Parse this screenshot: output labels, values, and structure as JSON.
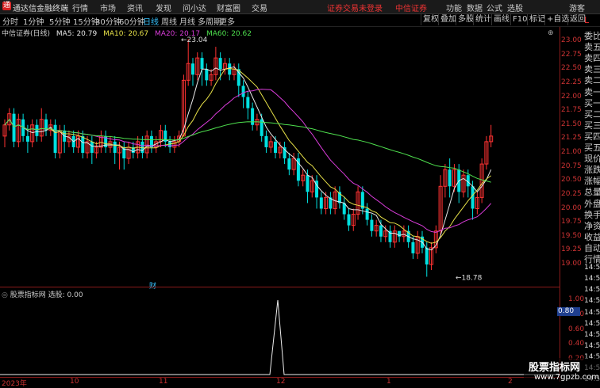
{
  "app": {
    "name": "通达信金融终端",
    "logo_text": "通"
  },
  "menu": [
    "行情",
    "市场",
    "资讯",
    "发现",
    "问小达",
    "财富圈",
    "交易"
  ],
  "status_red": [
    "证券交易未登录",
    "中信证券"
  ],
  "top_right": [
    "功能",
    "数据",
    "公式",
    "选股",
    "游客"
  ],
  "periods": [
    "分时",
    "1分钟",
    "5分钟",
    "15分钟",
    "30分钟",
    "60分钟",
    "日线",
    "周线",
    "月线",
    "多周期",
    "更多"
  ],
  "active_period": "日线",
  "toolbar_buttons": [
    "复权",
    "叠加",
    "多股",
    "统计",
    "画线",
    "F10",
    "标记",
    "+自选",
    "返回"
  ],
  "stock": {
    "title": "中信证券(日线)"
  },
  "ma": [
    {
      "label": "MA5: 20.79",
      "color": "#e8e8e8"
    },
    {
      "label": "MA10: 20.67",
      "color": "#e6e048"
    },
    {
      "label": "MA20: 20.17",
      "color": "#d93cd9"
    },
    {
      "label": "MA60: 20.62",
      "color": "#4ee04e"
    }
  ],
  "y_labels": [
    "23.00",
    "22.75",
    "22.50",
    "22.25",
    "22.00",
    "21.75",
    "21.50",
    "21.25",
    "21.00",
    "20.75",
    "20.50",
    "20.25",
    "20.00",
    "19.75",
    "19.50",
    "19.25",
    "19.00"
  ],
  "high_label": "23.04",
  "low_label": "18.78",
  "finance_mark": "财",
  "side_panel": [
    "委比",
    "卖五",
    "卖四",
    "卖三",
    "卖二",
    "卖一",
    "买一",
    "买二",
    "买三",
    "买四",
    "买五",
    "现价",
    "涨跌",
    "涨幅",
    "总量",
    "外盘",
    "换手",
    "净资",
    "收益",
    "自动",
    "行情",
    "14:50",
    "14:50",
    "14:50",
    "14:50",
    "14:50",
    "14:50",
    "14:50",
    "14:50",
    "14:50",
    "14:50",
    "14:50"
  ],
  "side_header": "L",
  "indicator": {
    "name": "股票指标网",
    "value_label": "选股: 0.00",
    "current": "0.80"
  },
  "sub_y_labels": [
    "1.00",
    "0.80",
    "0.60",
    "0.40",
    "0.20"
  ],
  "x_labels": [
    "2023年",
    "10",
    "11",
    "12",
    "1",
    "2"
  ],
  "watermark": {
    "line1": "股票指标网",
    "line2": "www.7gpzb.com"
  },
  "candles": [
    [
      21.3,
      21.5,
      21.1,
      21.6
    ],
    [
      21.5,
      21.7,
      21.4,
      21.8
    ],
    [
      21.7,
      21.2,
      21.1,
      21.8
    ],
    [
      21.2,
      21.6,
      21.1,
      21.7
    ],
    [
      21.6,
      21.3,
      21.2,
      21.7
    ],
    [
      21.3,
      21.2,
      21.0,
      21.5
    ],
    [
      21.2,
      21.5,
      21.1,
      21.6
    ],
    [
      21.5,
      21.3,
      21.2,
      21.6
    ],
    [
      21.3,
      21.6,
      21.2,
      21.8
    ],
    [
      21.6,
      21.4,
      21.3,
      21.7
    ],
    [
      21.4,
      21.5,
      21.3,
      21.6
    ],
    [
      21.5,
      21.0,
      20.9,
      21.6
    ],
    [
      21.0,
      21.4,
      20.9,
      21.5
    ],
    [
      21.4,
      21.2,
      21.0,
      21.5
    ],
    [
      21.2,
      21.3,
      21.1,
      21.4
    ],
    [
      21.3,
      21.1,
      21.0,
      21.4
    ],
    [
      21.1,
      21.3,
      21.0,
      21.4
    ],
    [
      21.3,
      21.0,
      20.9,
      21.4
    ],
    [
      21.0,
      21.2,
      20.9,
      21.3
    ],
    [
      21.2,
      21.0,
      20.8,
      21.3
    ],
    [
      21.0,
      21.1,
      20.9,
      21.2
    ],
    [
      21.1,
      21.3,
      21.0,
      21.4
    ],
    [
      21.3,
      21.1,
      21.0,
      21.4
    ],
    [
      21.1,
      21.2,
      21.0,
      21.3
    ],
    [
      21.2,
      21.0,
      20.8,
      21.3
    ],
    [
      21.0,
      21.1,
      20.7,
      21.2
    ],
    [
      21.1,
      20.9,
      20.7,
      21.2
    ],
    [
      20.9,
      21.1,
      20.8,
      21.2
    ],
    [
      21.1,
      21.0,
      20.9,
      21.2
    ],
    [
      21.0,
      21.2,
      20.9,
      21.3
    ],
    [
      21.2,
      21.0,
      20.9,
      21.3
    ],
    [
      21.0,
      21.3,
      20.9,
      21.4
    ],
    [
      21.3,
      21.1,
      21.0,
      21.4
    ],
    [
      21.1,
      21.2,
      21.0,
      21.3
    ],
    [
      21.2,
      21.4,
      21.1,
      21.5
    ],
    [
      21.4,
      21.2,
      21.1,
      21.5
    ],
    [
      21.2,
      21.1,
      21.0,
      21.3
    ],
    [
      21.1,
      21.2,
      21.0,
      21.3
    ],
    [
      21.2,
      21.3,
      21.1,
      21.4
    ],
    [
      21.3,
      22.3,
      21.3,
      22.4
    ],
    [
      22.3,
      22.6,
      22.2,
      23.04
    ],
    [
      22.6,
      22.4,
      22.2,
      22.7
    ],
    [
      22.4,
      22.7,
      22.3,
      22.8
    ],
    [
      22.7,
      22.5,
      22.2,
      22.8
    ],
    [
      22.5,
      22.3,
      22.2,
      22.6
    ],
    [
      22.3,
      22.4,
      22.2,
      22.5
    ],
    [
      22.4,
      22.7,
      22.3,
      22.9
    ],
    [
      22.7,
      22.5,
      22.3,
      22.8
    ],
    [
      22.5,
      22.6,
      22.4,
      22.7
    ],
    [
      22.6,
      22.4,
      22.3,
      22.7
    ],
    [
      22.4,
      22.5,
      22.3,
      22.6
    ],
    [
      22.5,
      22.2,
      22.0,
      22.6
    ],
    [
      22.2,
      22.0,
      21.8,
      22.3
    ],
    [
      22.0,
      21.8,
      21.6,
      22.1
    ],
    [
      21.8,
      21.5,
      21.4,
      21.9
    ],
    [
      21.5,
      21.6,
      21.4,
      21.7
    ],
    [
      21.6,
      21.3,
      21.2,
      21.7
    ],
    [
      21.3,
      21.1,
      21.0,
      21.4
    ],
    [
      21.1,
      21.2,
      21.0,
      21.3
    ],
    [
      21.2,
      21.0,
      20.9,
      21.3
    ],
    [
      21.0,
      21.1,
      20.9,
      21.2
    ],
    [
      21.1,
      20.9,
      20.8,
      21.2
    ],
    [
      20.9,
      20.7,
      20.6,
      21.0
    ],
    [
      20.7,
      20.9,
      20.6,
      21.0
    ],
    [
      20.9,
      20.5,
      20.4,
      21.0
    ],
    [
      20.5,
      20.6,
      20.4,
      20.7
    ],
    [
      20.6,
      20.3,
      20.1,
      20.7
    ],
    [
      20.3,
      20.5,
      20.2,
      20.6
    ],
    [
      20.5,
      20.2,
      20.0,
      20.6
    ],
    [
      20.2,
      20.0,
      19.9,
      20.3
    ],
    [
      20.0,
      20.2,
      19.9,
      20.3
    ],
    [
      20.2,
      20.0,
      19.9,
      20.3
    ],
    [
      20.0,
      20.3,
      19.9,
      20.4
    ],
    [
      20.3,
      20.1,
      20.0,
      20.4
    ],
    [
      20.1,
      19.9,
      19.8,
      20.2
    ],
    [
      19.9,
      19.7,
      19.6,
      20.0
    ],
    [
      19.7,
      19.9,
      19.6,
      20.0
    ],
    [
      19.9,
      20.3,
      19.8,
      20.4
    ],
    [
      20.3,
      20.0,
      19.9,
      20.4
    ],
    [
      20.0,
      19.8,
      19.7,
      20.1
    ],
    [
      19.8,
      19.6,
      19.5,
      19.9
    ],
    [
      19.6,
      19.7,
      19.5,
      19.8
    ],
    [
      19.7,
      19.5,
      19.4,
      19.8
    ],
    [
      19.5,
      19.6,
      19.4,
      19.7
    ],
    [
      19.6,
      19.4,
      19.3,
      19.7
    ],
    [
      19.4,
      19.6,
      19.3,
      19.7
    ],
    [
      19.6,
      19.5,
      19.4,
      19.6
    ],
    [
      19.5,
      19.6,
      19.4,
      19.7
    ],
    [
      19.6,
      19.4,
      19.3,
      19.7
    ],
    [
      19.4,
      19.2,
      19.1,
      19.5
    ],
    [
      19.2,
      19.5,
      19.1,
      19.6
    ],
    [
      19.5,
      19.3,
      19.2,
      19.6
    ],
    [
      19.3,
      19.0,
      18.78,
      19.4
    ],
    [
      19.0,
      19.3,
      18.9,
      19.4
    ],
    [
      19.3,
      19.6,
      19.2,
      19.7
    ],
    [
      19.6,
      20.4,
      19.5,
      20.6
    ],
    [
      20.4,
      20.7,
      20.2,
      20.8
    ],
    [
      20.7,
      20.4,
      20.2,
      20.9
    ],
    [
      20.4,
      20.7,
      20.3,
      20.8
    ],
    [
      20.7,
      20.3,
      20.1,
      20.8
    ],
    [
      20.3,
      20.6,
      20.2,
      20.7
    ],
    [
      20.6,
      20.4,
      20.2,
      20.7
    ],
    [
      20.4,
      20.0,
      19.8,
      20.5
    ],
    [
      20.0,
      20.2,
      19.9,
      20.3
    ],
    [
      20.2,
      20.8,
      20.1,
      20.9
    ],
    [
      20.8,
      21.2,
      20.7,
      21.3
    ],
    [
      21.2,
      21.3,
      21.1,
      21.5
    ]
  ]
}
